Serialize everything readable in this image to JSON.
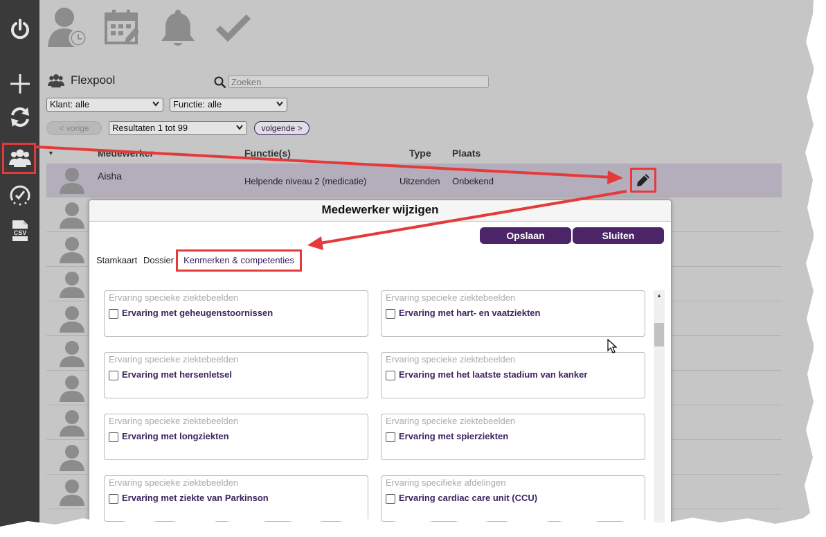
{
  "header": {
    "page_title": "Flexpool"
  },
  "search": {
    "placeholder": "Zoeken"
  },
  "filters": {
    "client": "Klant: alle",
    "function": "Functie: alle"
  },
  "pagination": {
    "prev_label": "< vorige",
    "results": "Resultaten 1 tot 99",
    "next_label": "volgende >"
  },
  "table": {
    "columns": [
      "Medewerker",
      "Functie(s)",
      "Type",
      "Plaats"
    ],
    "selected_row": {
      "name": "Aisha",
      "function": "Helpende niveau 2 (medicatie)",
      "type": "Uitzenden",
      "place": "Onbekend"
    }
  },
  "modal": {
    "title": "Medewerker wijzigen",
    "save_label": "Opslaan",
    "close_label": "Sluiten",
    "tabs": [
      "Stamkaart",
      "Dossier",
      "Kenmerken & competenties"
    ],
    "cards": [
      {
        "category": "Ervaring specieke ziektebeelden",
        "label": "Ervaring met geheugenstoornissen"
      },
      {
        "category": "Ervaring specieke ziektebeelden",
        "label": "Ervaring met hart- en vaatziekten"
      },
      {
        "category": "Ervaring specieke ziektebeelden",
        "label": "Ervaring met hersenletsel"
      },
      {
        "category": "Ervaring specieke ziektebeelden",
        "label": "Ervaring met het laatste stadium van kanker"
      },
      {
        "category": "Ervaring specieke ziektebeelden",
        "label": "Ervaring met longziekten"
      },
      {
        "category": "Ervaring specieke ziektebeelden",
        "label": "Ervaring met spierziekten"
      },
      {
        "category": "Ervaring specieke ziektebeelden",
        "label": "Ervaring met ziekte van Parkinson"
      },
      {
        "category": "Ervaring specifieke afdelingen",
        "label": "Ervaring cardiac care unit (CCU)"
      }
    ]
  },
  "colors": {
    "sidebar": "#3a3a3a",
    "accent": "#4c2468",
    "highlight": "#e53a3a"
  },
  "icons": [
    "power-icon",
    "plus-icon",
    "refresh-icon",
    "users-icon",
    "speedometer-icon",
    "csv-icon",
    "user-clock-icon",
    "calendar-edit-icon",
    "bell-icon",
    "check-icon",
    "search-icon",
    "edit-pencil-icon"
  ]
}
